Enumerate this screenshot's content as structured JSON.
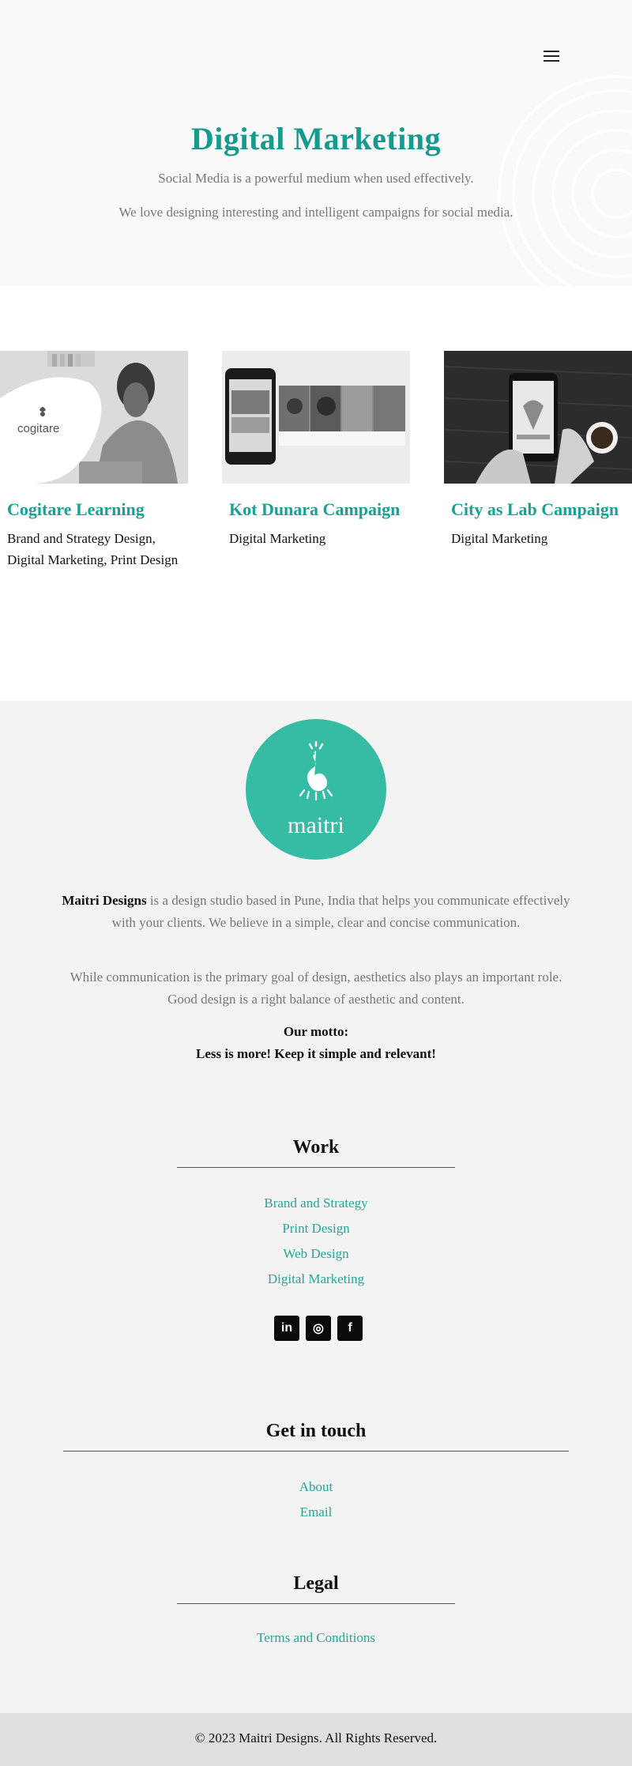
{
  "hero": {
    "title": "Digital Marketing",
    "subtitle_1": "Social Media is a powerful medium when used effectively.",
    "subtitle_2": "We love designing interesting and intelligent campaigns for social media.",
    "menu_icon": "hamburger-menu-icon"
  },
  "portfolio": [
    {
      "title": "Cogitare Learning",
      "categories": "Brand and Strategy Design, Digital Marketing, Print Design",
      "logo_text": "cogitare"
    },
    {
      "title": "Kot Dunara Campaign",
      "categories": "Digital Marketing"
    },
    {
      "title": "City as Lab Campaign",
      "categories": "Digital Marketing"
    }
  ],
  "footer": {
    "logo_text": "maitri",
    "about_brand": "Maitri Designs",
    "about_text": " is a design studio based in Pune, India that helps you communicate effectively with your clients. We believe in a simple, clear and concise communication.",
    "about_text_2": "While communication is the primary goal of design, aesthetics also plays an important role. Good design is a right balance of aesthetic and content.",
    "motto_label": "Our motto:",
    "motto": "Less is more!  Keep it simple and relevant!",
    "work": {
      "title": "Work",
      "links": [
        "Brand and Strategy",
        "Print Design",
        "Web Design",
        "Digital Marketing"
      ]
    },
    "social": [
      {
        "icon": "linkedin-icon",
        "glyph": "in"
      },
      {
        "icon": "instagram-icon",
        "glyph": "◎"
      },
      {
        "icon": "facebook-icon",
        "glyph": "f"
      }
    ],
    "contact": {
      "title": "Get in touch",
      "links": [
        "About",
        "Email"
      ]
    },
    "legal": {
      "title": "Legal",
      "links": [
        "Terms and Conditions"
      ]
    },
    "copyright": "© 2023 Maitri Designs. All Rights Reserved."
  },
  "colors": {
    "accent": "#159a8f",
    "logo_bg": "#36bca4",
    "footer_bg": "#f3f3f3",
    "copyright_bg": "#dfdfdf"
  }
}
